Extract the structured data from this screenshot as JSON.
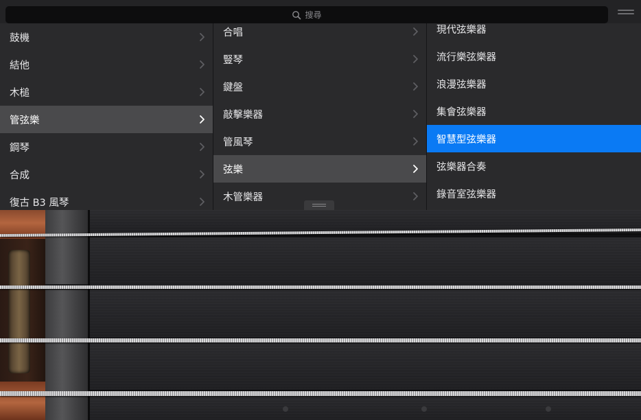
{
  "search": {
    "label": "搜尋",
    "icon": "magnifier"
  },
  "browser": {
    "column1": [
      {
        "label": "鼓機",
        "selected": false
      },
      {
        "label": "結他",
        "selected": false
      },
      {
        "label": "木槌",
        "selected": false
      },
      {
        "label": "管弦樂",
        "selected": true
      },
      {
        "label": "鋼琴",
        "selected": false
      },
      {
        "label": "合成",
        "selected": false
      },
      {
        "label": "復古 B3 風琴",
        "selected": false
      }
    ],
    "column2": [
      {
        "label": "合唱",
        "selected": false
      },
      {
        "label": "豎琴",
        "selected": false
      },
      {
        "label": "鍵盤",
        "selected": false
      },
      {
        "label": "敲擊樂器",
        "selected": false
      },
      {
        "label": "管風琴",
        "selected": false
      },
      {
        "label": "弦樂",
        "selected": true
      },
      {
        "label": "木管樂器",
        "selected": false
      }
    ],
    "column3": [
      {
        "label": "現代弦樂器",
        "selected": false
      },
      {
        "label": "流行樂弦樂器",
        "selected": false
      },
      {
        "label": "浪漫弦樂器",
        "selected": false
      },
      {
        "label": "集會弦樂器",
        "selected": false
      },
      {
        "label": "智慧型弦樂器",
        "selected": true
      },
      {
        "label": "弦樂器合奏",
        "selected": false
      },
      {
        "label": "錄音室弦樂器",
        "selected": false
      }
    ]
  },
  "colors": {
    "selection_blue": "#0a7af4",
    "selection_grey": "#4a4a4c"
  },
  "instrument": {
    "strings_count": 4
  }
}
